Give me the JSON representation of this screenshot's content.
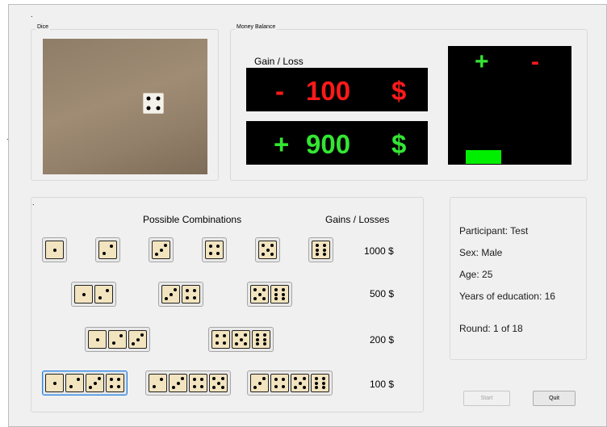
{
  "groups": {
    "dice_title": "Dice",
    "money_title": "Money Balance",
    "combo_title": ""
  },
  "dice_roll": {
    "value": 4
  },
  "money": {
    "gain_loss_label": "Gain / Loss",
    "loss_sign": "-",
    "loss_amount": "100",
    "loss_currency": "$",
    "gain_sign": "+",
    "gain_amount": "900",
    "gain_currency": "$",
    "meter_plus": "+",
    "meter_minus": "-",
    "meter_level_note": "green bar low"
  },
  "combinations": {
    "header_combinations": "Possible Combinations",
    "header_gains": "Gains / Losses",
    "rows": [
      {
        "amount": "1000 $",
        "groups": [
          [
            1
          ],
          [
            2
          ],
          [
            3
          ],
          [
            4
          ],
          [
            5
          ],
          [
            6
          ]
        ]
      },
      {
        "amount": "500 $",
        "groups": [
          [
            1,
            2
          ],
          [
            3,
            4
          ],
          [
            5,
            6
          ]
        ]
      },
      {
        "amount": "200 $",
        "groups": [
          [
            1,
            2,
            3
          ],
          [
            4,
            5,
            6
          ]
        ]
      },
      {
        "amount": "100 $",
        "groups": [
          [
            1,
            2,
            3,
            4
          ],
          [
            2,
            3,
            4,
            5
          ],
          [
            3,
            4,
            5,
            6
          ]
        ]
      }
    ],
    "selected": "row4-group1"
  },
  "participant": {
    "participant": "Participant: Test",
    "sex": "Sex: Male",
    "age": "Age: 25",
    "education": "Years of education: 16",
    "round": "Round: 1 of 18"
  },
  "buttons": {
    "start": "Start",
    "quit": "Quit"
  },
  "colors": {
    "loss": "#ff1a1a",
    "gain": "#33e633",
    "die_face": "#f2e4bf"
  }
}
